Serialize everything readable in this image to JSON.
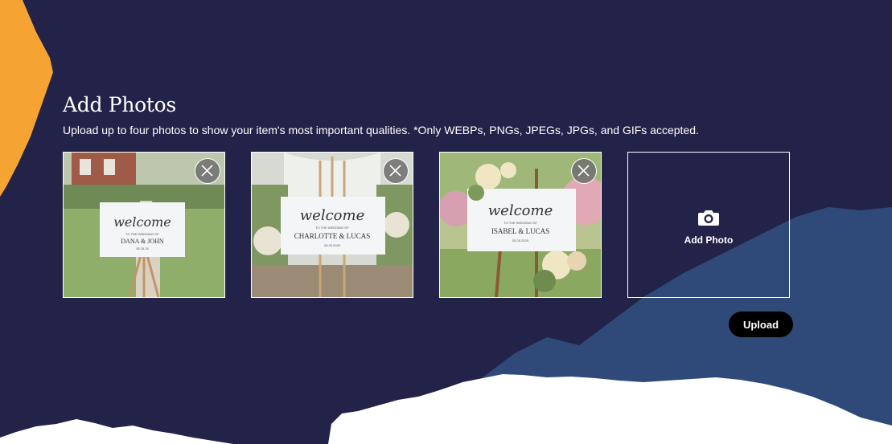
{
  "section": {
    "title": "Add Photos",
    "subtitle": "Upload up to four photos to show your item's most important qualities. *Only WEBPs, PNGs, JPEGs, JPGs, and GIFs accepted."
  },
  "photos": [
    {
      "sign_script": "welcome",
      "sign_line1": "TO THE WEDDING OF",
      "sign_names": "DANA & JOHN",
      "sign_date": "05.25.25",
      "remove_icon": "close-icon"
    },
    {
      "sign_script": "welcome",
      "sign_line1": "TO THE WEDDING OF",
      "sign_names": "CHARLOTTE & LUCAS",
      "sign_date": "05.25.2025",
      "remove_icon": "close-icon"
    },
    {
      "sign_script": "welcome",
      "sign_line1": "TO THE WEDDING OF",
      "sign_names": "ISABEL & LUCAS",
      "sign_date": "05.25.2025",
      "remove_icon": "close-icon"
    }
  ],
  "add_tile": {
    "label": "Add Photo",
    "icon": "camera-icon"
  },
  "upload_button": {
    "label": "Upload"
  },
  "colors": {
    "background": "#232249",
    "accent_orange": "#f5a434",
    "wave_blue": "#2f4a78",
    "button": "#000000"
  }
}
